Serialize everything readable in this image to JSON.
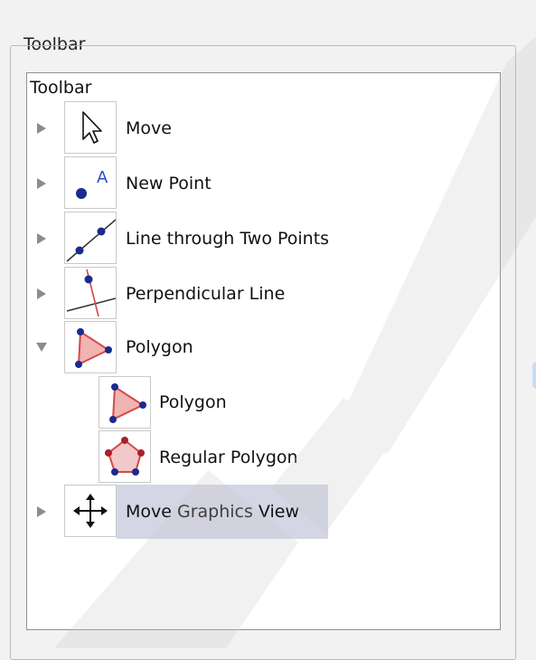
{
  "group": {
    "legend": "Toolbar"
  },
  "tree": {
    "root_label": "Toolbar",
    "items": [
      {
        "label": "Move",
        "icon": "cursor-arrow-icon",
        "expanded": false
      },
      {
        "label": "New Point",
        "icon": "new-point-icon",
        "expanded": false
      },
      {
        "label": "Line through Two Points",
        "icon": "line-two-points-icon",
        "expanded": false
      },
      {
        "label": "Perpendicular Line",
        "icon": "perpendicular-line-icon",
        "expanded": false
      },
      {
        "label": "Polygon",
        "icon": "polygon-icon",
        "expanded": true,
        "children": [
          {
            "label": "Polygon",
            "icon": "polygon-icon"
          },
          {
            "label": "Regular Polygon",
            "icon": "regular-polygon-icon"
          }
        ]
      },
      {
        "label": "Move Graphics View",
        "icon": "move-graphics-view-icon",
        "expanded": false,
        "selected": true
      }
    ]
  },
  "colors": {
    "selection": "#d4d6e6",
    "point": "#1a2a8f",
    "polygon_fill": "#f2b3b3",
    "polygon_edge": "#d44a4a",
    "regular_vertex": "#a8202a"
  }
}
